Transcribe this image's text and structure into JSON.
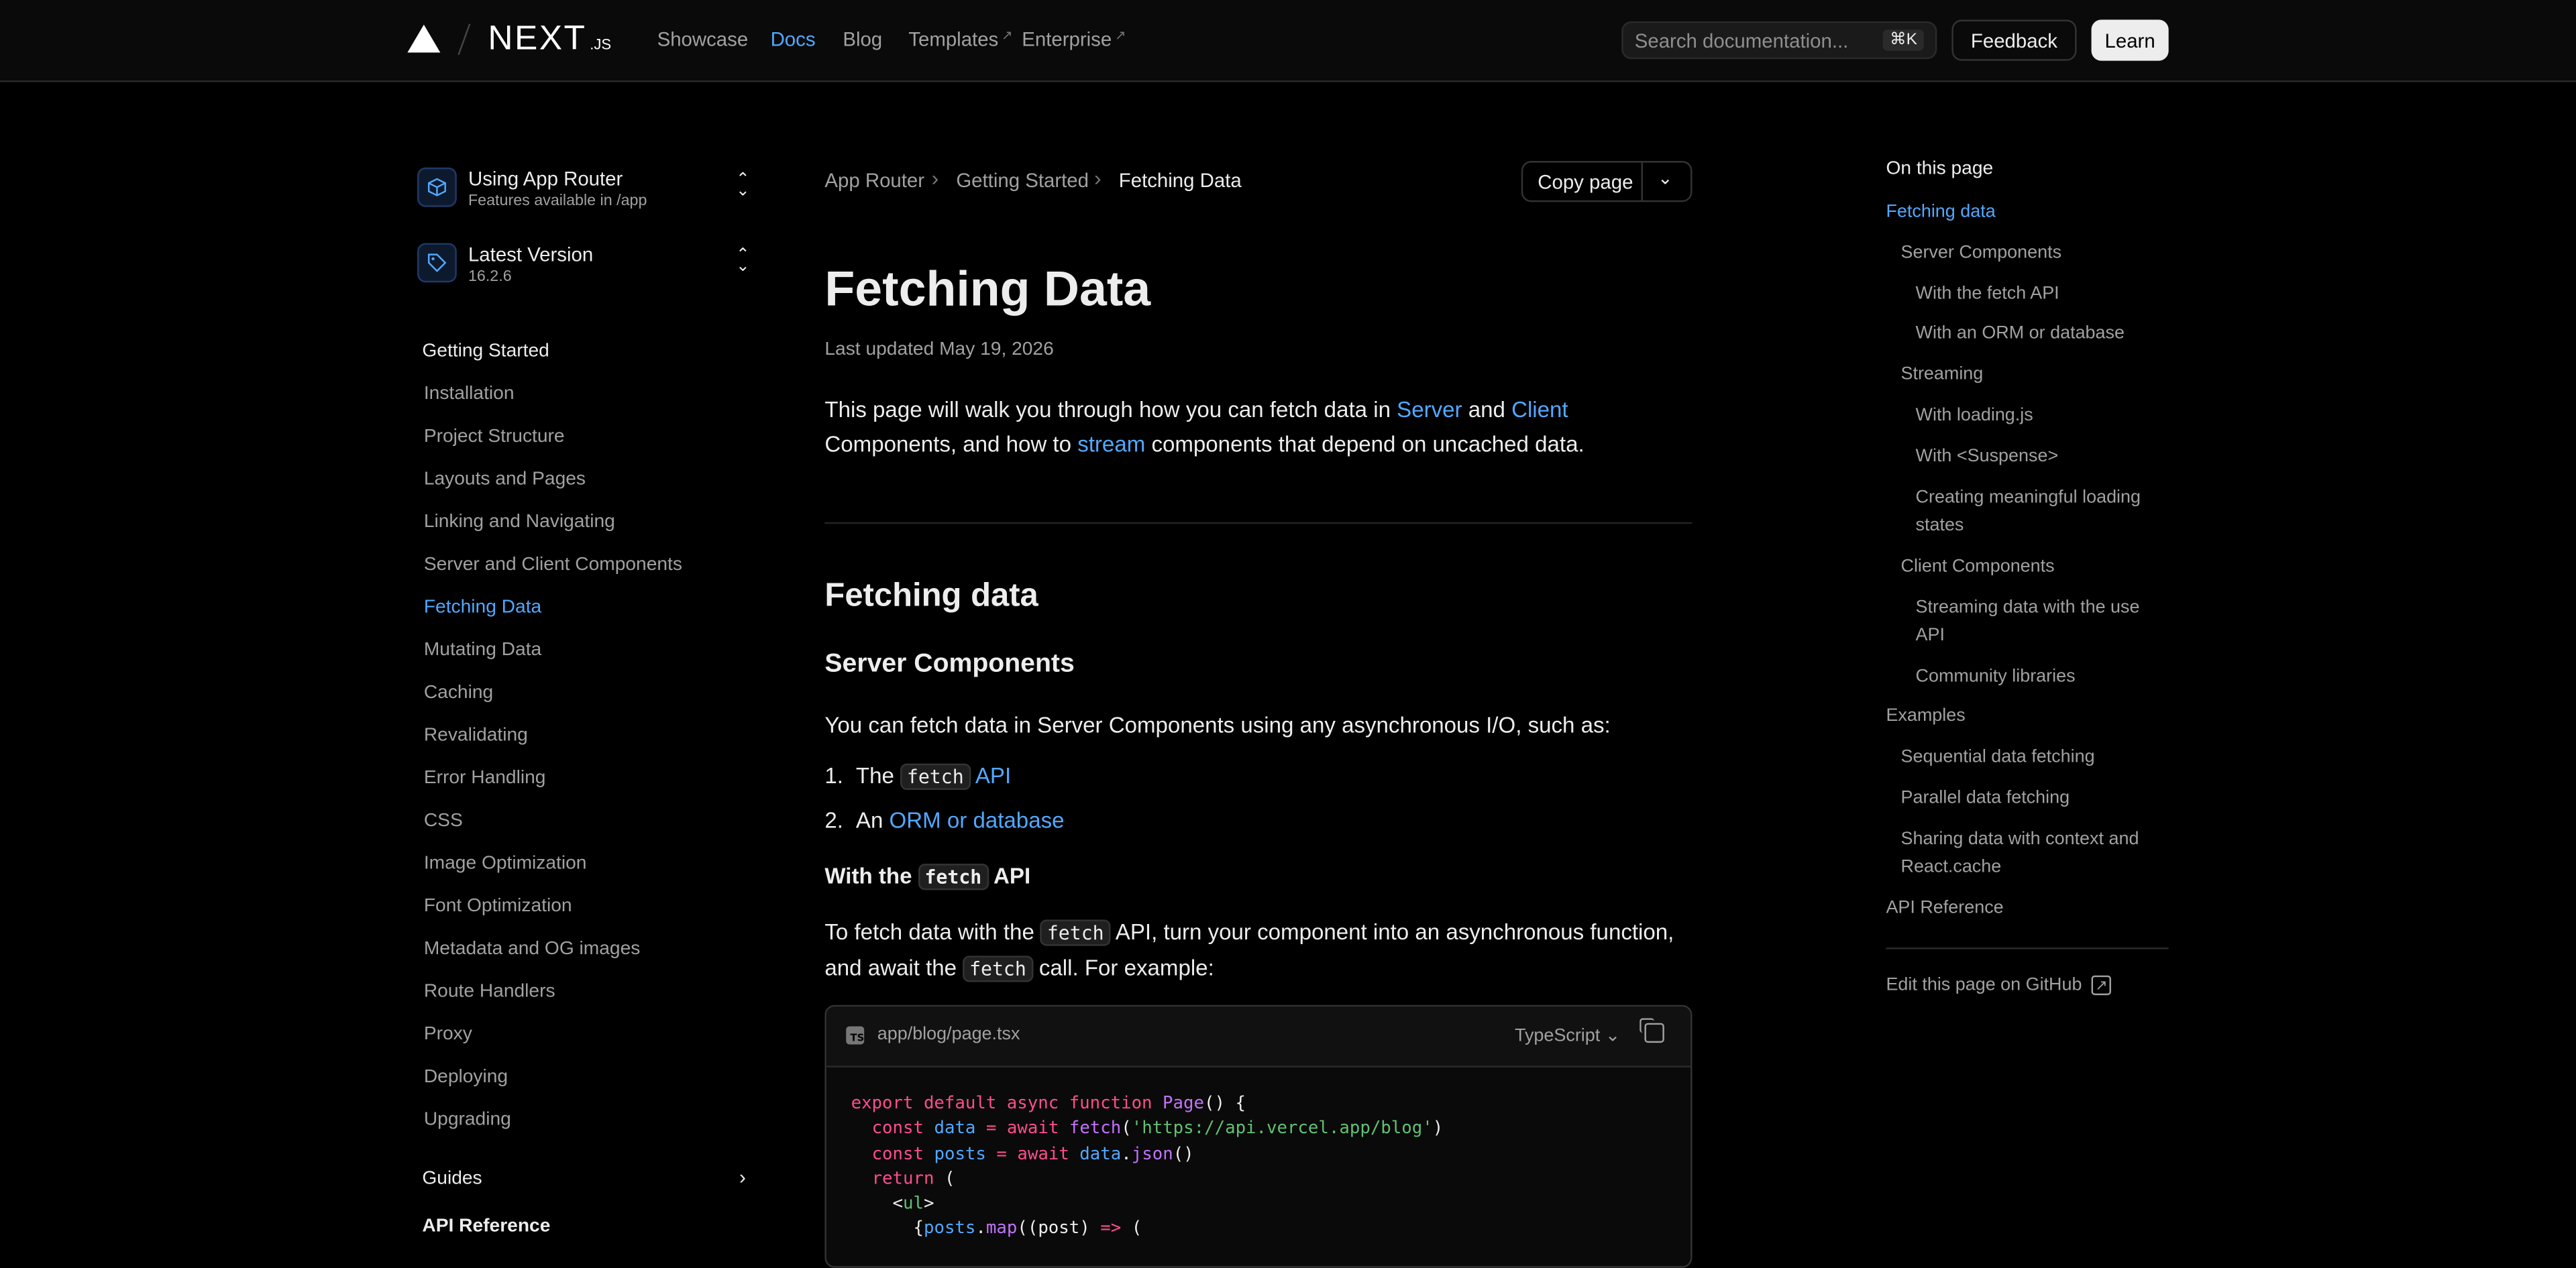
{
  "header": {
    "logo_word": "NEXT",
    "logo_suffix": ".JS",
    "nav": [
      "Showcase",
      "Docs",
      "Blog",
      "Templates",
      "Enterprise"
    ],
    "search_placeholder": "Search documentation...",
    "search_shortcut": "⌘K",
    "feedback": "Feedback",
    "learn": "Learn"
  },
  "sidebar": {
    "router_title": "Using App Router",
    "router_sub": "Features available in /app",
    "version_title": "Latest Version",
    "version_sub": "16.2.6",
    "section": "Getting Started",
    "items": [
      "Installation",
      "Project Structure",
      "Layouts and Pages",
      "Linking and Navigating",
      "Server and Client Components",
      "Fetching Data",
      "Mutating Data",
      "Caching",
      "Revalidating",
      "Error Handling",
      "CSS",
      "Image Optimization",
      "Font Optimization",
      "Metadata and OG images",
      "Route Handlers",
      "Proxy",
      "Deploying",
      "Upgrading"
    ],
    "guides": "Guides",
    "api_ref": "API Reference"
  },
  "main": {
    "breadcrumb": [
      "App Router",
      "Getting Started",
      "Fetching Data"
    ],
    "copy_page": "Copy page",
    "title": "Fetching Data",
    "updated": "Last updated May 19, 2026",
    "intro": {
      "p1": "This page will walk you through how you can fetch data in ",
      "server": "Server",
      "and": " and ",
      "client": "Client",
      "p2": " Components, and how to ",
      "stream": "stream",
      "p3": " components that depend on uncached data."
    },
    "h2": "Fetching data",
    "h3": "Server Components",
    "server_intro": "You can fetch data in Server Components using any asynchronous I/O, such as:",
    "list": {
      "n1": "1.",
      "the": "The ",
      "fetch": "fetch",
      "api": " API",
      "n2": "2.",
      "an": "An ",
      "orm": "ORM or database"
    },
    "h4": {
      "with": "With the ",
      "fetch": "fetch",
      "api": " API"
    },
    "fetch_para": {
      "a": "To fetch data with the ",
      "fetch": "fetch",
      "b": " API, turn your component into an asynchronous function, and await the ",
      "c": " call. For example:"
    },
    "code": {
      "filename": "app/blog/page.tsx",
      "language": "TypeScript",
      "ts_icon": "TS"
    }
  },
  "toc": {
    "heading": "On this page",
    "items": [
      "Fetching data",
      "Server Components",
      "With the fetch API",
      "With an ORM or database",
      "Streaming",
      "With loading.js",
      "With <Suspense>",
      "Creating meaningful loading states",
      "Client Components",
      "Streaming data with the use API",
      "Community libraries",
      "Examples",
      "Sequential data fetching",
      "Parallel data fetching",
      "Sharing data with context and React.cache",
      "API Reference"
    ],
    "edit": "Edit this page on GitHub"
  }
}
